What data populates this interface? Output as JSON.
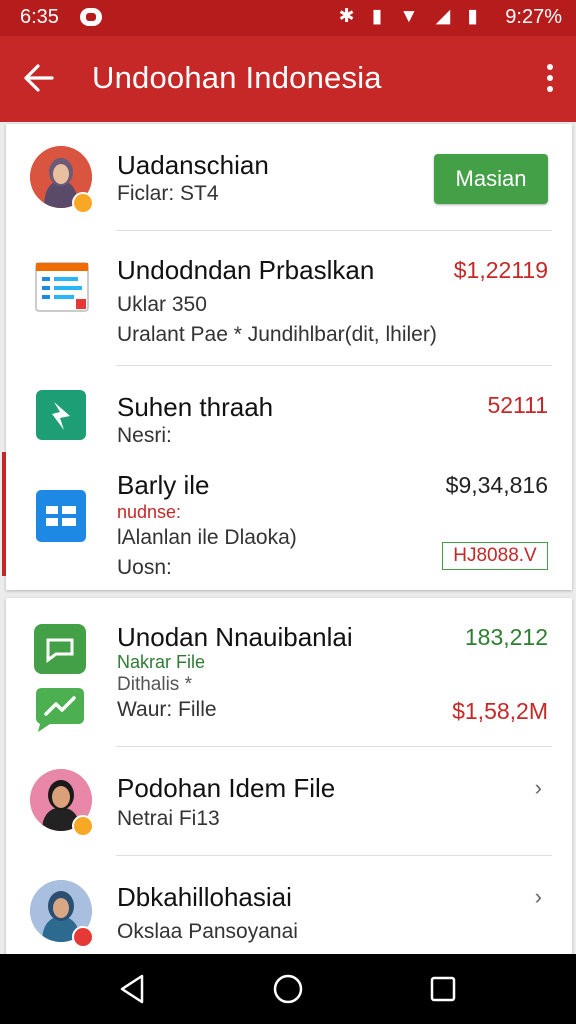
{
  "status": {
    "time": "6:35",
    "icons": "✱ ▮ ▼ ◢ ▮",
    "clock2": "9:27%"
  },
  "appbar": {
    "title": "Undoohan Indonesia"
  },
  "card1": {
    "header": {
      "name": "Uadanschian",
      "sub": "Ficlar: ST4",
      "button": "Masian"
    },
    "item1": {
      "title": "Undodndan Prbaslkan",
      "line1": "Uklar 350",
      "line2": "Uralant Pae * Jundihlbar(dit, lhiler)",
      "amount": "$1,22119"
    },
    "item2": {
      "title": "Suhen thraah",
      "line1": "Nesri:",
      "amount": "52111"
    },
    "item3": {
      "title": "Barly ile",
      "tag": "nudnse:",
      "line1": "lAlanlan ile Dlaoka)",
      "line2": "Uosn:",
      "amount": "$9,34,816",
      "chip": "HJ8088.V"
    }
  },
  "card2": {
    "item1": {
      "title": "Unodan Nnauibanlai",
      "tag": "Nakrar File",
      "line1": "Dithalis *",
      "line2": "Waur: Fille",
      "amount_top": "183,212",
      "amount_bottom": "$1,58,2M"
    },
    "item2": {
      "title": "Podohan Idem File",
      "sub": "Netrai Fi13",
      "chevron": "›"
    },
    "item3": {
      "title": "Dbkahillohasiai",
      "sub": "Okslaa Pansoyanai",
      "chevron": "›"
    }
  },
  "colors": {
    "primary": "#c62828",
    "accent_green": "#43a047"
  }
}
